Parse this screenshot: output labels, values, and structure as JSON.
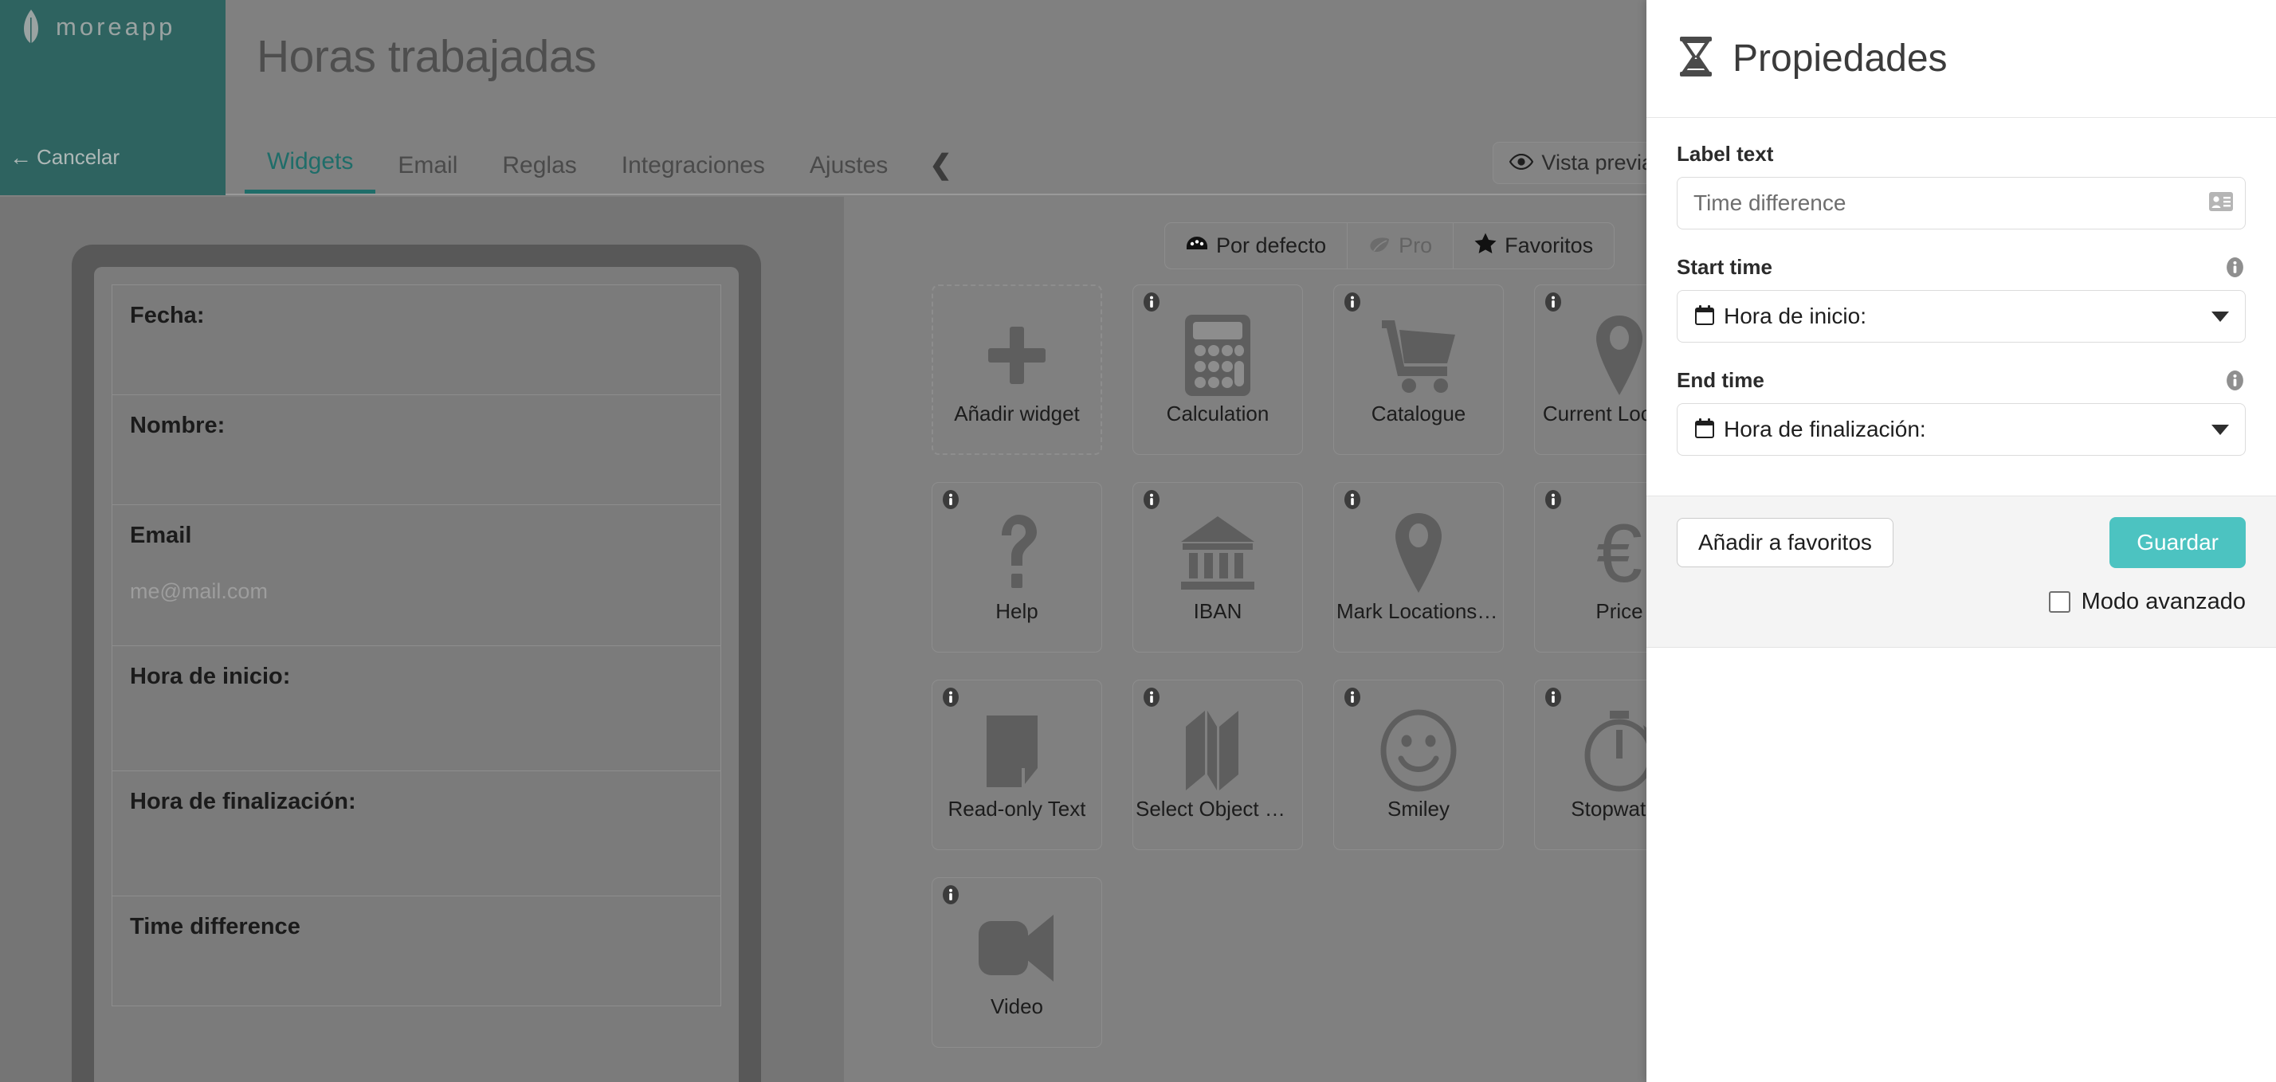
{
  "brand": {
    "logo_word": "moreapp",
    "teal": "#2e6360",
    "accent_teal": "#1f6d69",
    "save_green": "#4cc3c1"
  },
  "sidebar": {
    "cancel_label": "Cancelar"
  },
  "header": {
    "title": "Horas trabajadas",
    "preview_label": "Vista previa"
  },
  "tabs": [
    {
      "label": "Widgets",
      "active": true
    },
    {
      "label": "Email",
      "active": false
    },
    {
      "label": "Reglas",
      "active": false
    },
    {
      "label": "Integraciones",
      "active": false
    },
    {
      "label": "Ajustes",
      "active": false
    }
  ],
  "form_preview": {
    "rows": [
      {
        "label": "Fecha:",
        "value": ""
      },
      {
        "label": "Nombre:",
        "value": ""
      },
      {
        "label": "Email",
        "value": "me@mail.com"
      },
      {
        "label": "Hora de inicio:",
        "value": ""
      },
      {
        "label": "Hora de finalización:",
        "value": ""
      },
      {
        "label": "Time difference",
        "value": ""
      }
    ]
  },
  "widget_filters": [
    {
      "label": "Por defecto",
      "icon": "dashboard-icon",
      "state": "enabled"
    },
    {
      "label": "Pro",
      "icon": "leaf-icon",
      "state": "disabled"
    },
    {
      "label": "Favoritos",
      "icon": "star-icon",
      "state": "enabled"
    }
  ],
  "widgets": [
    {
      "label": "Añadir widget",
      "icon": "plus-icon",
      "add": true,
      "info": false
    },
    {
      "label": "Calculation",
      "icon": "calculator-icon",
      "add": false,
      "info": true
    },
    {
      "label": "Catalogue",
      "icon": "shopping-cart-icon",
      "add": false,
      "info": true
    },
    {
      "label": "Current Location",
      "icon": "map-pin-icon",
      "add": false,
      "info": true
    },
    {
      "label": "Help",
      "icon": "question-mark-icon",
      "add": false,
      "info": true
    },
    {
      "label": "IBAN",
      "icon": "bank-icon",
      "add": false,
      "info": true
    },
    {
      "label": "Mark Locations o...",
      "icon": "map-pin-icon",
      "add": false,
      "info": true
    },
    {
      "label": "Price",
      "icon": "euro-icon",
      "add": false,
      "info": true
    },
    {
      "label": "Read-only Text",
      "icon": "document-icon",
      "add": false,
      "info": true
    },
    {
      "label": "Select Object On ...",
      "icon": "folded-map-icon",
      "add": false,
      "info": true
    },
    {
      "label": "Smiley",
      "icon": "smiley-icon",
      "add": false,
      "info": true
    },
    {
      "label": "Stopwatch",
      "icon": "stopwatch-icon",
      "add": false,
      "info": true
    },
    {
      "label": "Video",
      "icon": "video-camera-icon",
      "add": false,
      "info": true
    }
  ],
  "properties": {
    "title": "Propiedades",
    "head_icon": "hourglass-icon",
    "label_text": {
      "label": "Label text",
      "value": "Time difference",
      "icon": "contact-card-icon"
    },
    "start_time": {
      "label": "Start time",
      "value": "Hora de inicio:",
      "icon": "calendar-icon",
      "info": "info-icon"
    },
    "end_time": {
      "label": "End time",
      "value": "Hora de finalización:",
      "icon": "calendar-icon",
      "info": "info-icon"
    },
    "footer": {
      "favorite_label": "Añadir a favoritos",
      "save_label": "Guardar",
      "advanced_label": "Modo avanzado",
      "advanced_checked": false
    }
  }
}
